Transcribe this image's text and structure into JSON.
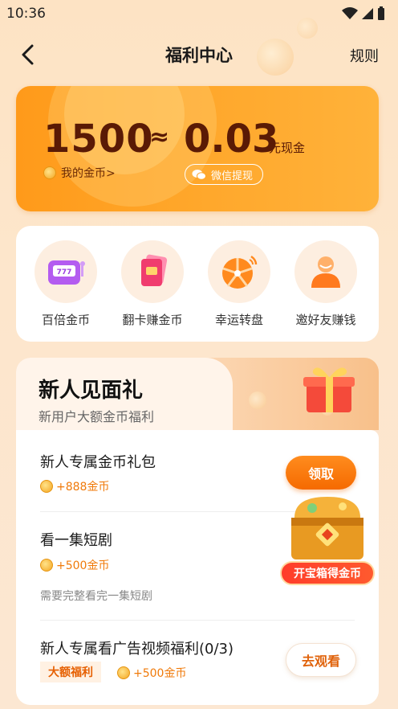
{
  "status": {
    "time": "10:36"
  },
  "header": {
    "title": "福利中心",
    "rules_label": "规则"
  },
  "balance": {
    "coins": "1500",
    "approx": "≈",
    "cash": "0.03",
    "cash_unit": "元现金",
    "my_coins_label": "我的金币>",
    "withdraw_label": "微信提现"
  },
  "games": [
    {
      "label": "百倍金币",
      "icon": "slot-machine-icon"
    },
    {
      "label": "翻卡赚金币",
      "icon": "flip-card-icon"
    },
    {
      "label": "幸运转盘",
      "icon": "lucky-wheel-icon"
    },
    {
      "label": "邀好友赚钱",
      "icon": "invite-friend-icon"
    }
  ],
  "gift": {
    "title": "新人见面礼",
    "subtitle": "新用户大额金币福利",
    "tasks": [
      {
        "title": "新人专属金币礼包",
        "reward": "+888金币",
        "button": "领取"
      },
      {
        "title": "看一集短剧",
        "reward": "+500金币",
        "note": "需要完整看完一集短剧"
      },
      {
        "title": "新人专属看广告视频福利(0/3)",
        "badge": "大额福利",
        "reward": "+500金币",
        "button": "去观看"
      }
    ],
    "treasure_label": "开宝箱得金币"
  },
  "colors": {
    "accent": "#ff8a00",
    "deep_brown": "#5a1a05",
    "reward_orange": "#f07a0a"
  }
}
